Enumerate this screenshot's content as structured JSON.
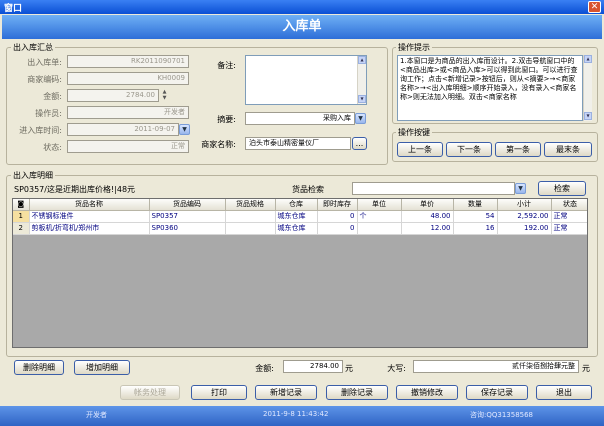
{
  "window": {
    "title": "窗口",
    "close_glyph": "✕",
    "header": "入库单"
  },
  "summary": {
    "legend": "出入库汇总",
    "fields": [
      {
        "label": "出入库单:",
        "value": "RK2011090701"
      },
      {
        "label": "商家编码:",
        "value": "KH0009"
      },
      {
        "label": "金额:",
        "value": "2784.00"
      },
      {
        "label": "操作员:",
        "value": "开发者"
      },
      {
        "label": "进入库时间:",
        "value": "2011-09-07"
      },
      {
        "label": "状态:",
        "value": "正常"
      }
    ],
    "notes_label": "备注:",
    "notes_value": "",
    "abstract_label": "摘要:",
    "abstract_value": "采购入库",
    "merchant_label": "商家名称:",
    "merchant_value": "泊头市泰山精密量仪厂",
    "merchant_btn": "..."
  },
  "tips": {
    "legend": "操作提示",
    "text": "1.本窗口是为商品的出入库而设计。2.双击导航窗口中的<商品出库>或<商品入库>可以得到此窗口。可以进行查询工作；点击<新增记录>按钮后，则从<摘要>→<商家名称>→<出入库明细>顺序开始录入，没有录入<商家名称>则无法加入明细。双击<商家名称"
  },
  "nav": {
    "legend": "操作按键",
    "first_row": [
      "上一条",
      "下一条",
      "第一条",
      "最末条"
    ]
  },
  "detail": {
    "legend": "出入库明细",
    "recent_price": "SP0357/这是近期出库价格!|48元",
    "search_label": "货品检索",
    "search_value": "",
    "search_btn": "检索",
    "columns": [
      "",
      "货品名称",
      "货品编码",
      "货品规格",
      "仓库",
      "即时库存",
      "单位",
      "单价",
      "数量",
      "小计",
      "状态"
    ],
    "rows": [
      {
        "idx": "1",
        "name": "不锈钢标准件",
        "code": "SP0357",
        "spec": "",
        "warehouse": "城东仓库",
        "stock": "0",
        "unit": "个",
        "price": "48.00",
        "qty": "54",
        "subtotal": "2,592.00",
        "status": "正常"
      },
      {
        "idx": "2",
        "name": "剪板机/折弯机/郑州市",
        "code": "SP0360",
        "spec": "",
        "warehouse": "城东仓库",
        "stock": "0",
        "unit": "",
        "price": "12.00",
        "qty": "16",
        "subtotal": "192.00",
        "status": "正常"
      }
    ],
    "delete_btn": "删除明细",
    "add_btn": "增加明细",
    "amount_label": "金额:",
    "amount_value": "2784.00",
    "amount_unit": "元",
    "upper_label": "大写:",
    "upper_value": "贰仟柒佰捌拾肆元整",
    "upper_unit": "元"
  },
  "bottom_buttons": {
    "audit": "帐务处理",
    "print": "打印",
    "new": "新增记录",
    "delete": "删除记录",
    "undo": "撤销修改",
    "save": "保存记录",
    "exit": "退出"
  },
  "status": {
    "user": "开发者",
    "datetime": "2011-9-8  11:43:42",
    "contact": "咨询:QQ31358568"
  }
}
